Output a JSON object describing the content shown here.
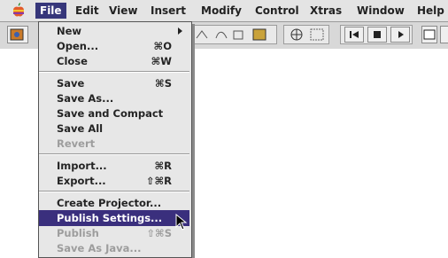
{
  "menubar": {
    "items": [
      "File",
      "Edit",
      "View",
      "Insert",
      "Modify",
      "Control",
      "Xtras",
      "Window",
      "Help"
    ],
    "active": "File"
  },
  "file_menu": {
    "items": [
      {
        "label": "New",
        "shortcut": "",
        "submenu": true,
        "enabled": true,
        "highlighted": false
      },
      {
        "label": "Open...",
        "shortcut": "⌘O",
        "enabled": true,
        "highlighted": false
      },
      {
        "label": "Close",
        "shortcut": "⌘W",
        "enabled": true,
        "highlighted": false
      },
      {
        "label": "Save",
        "shortcut": "⌘S",
        "enabled": true,
        "highlighted": false
      },
      {
        "label": "Save As...",
        "shortcut": "",
        "enabled": true,
        "highlighted": false
      },
      {
        "label": "Save and Compact",
        "shortcut": "",
        "enabled": true,
        "highlighted": false
      },
      {
        "label": "Save All",
        "shortcut": "",
        "enabled": true,
        "highlighted": false
      },
      {
        "label": "Revert",
        "shortcut": "",
        "enabled": false,
        "highlighted": false
      },
      {
        "label": "Import...",
        "shortcut": "⌘R",
        "enabled": true,
        "highlighted": false
      },
      {
        "label": "Export...",
        "shortcut": "⇧⌘R",
        "enabled": true,
        "highlighted": false
      },
      {
        "label": "Create Projector...",
        "shortcut": "",
        "enabled": true,
        "highlighted": false
      },
      {
        "label": "Publish Settings...",
        "shortcut": "",
        "enabled": true,
        "highlighted": true
      },
      {
        "label": "Publish",
        "shortcut": "⇧⌘S",
        "enabled": false,
        "highlighted": false
      },
      {
        "label": "Save As Java...",
        "shortcut": "",
        "enabled": false,
        "highlighted": false
      }
    ]
  },
  "colors": {
    "menubar_bg": "#e4e4e4",
    "highlight": "#3a2f7d",
    "disabled_text": "#9d9d9d"
  },
  "icons": [
    "apple-icon",
    "stop-icon",
    "play-icon",
    "rewind-icon"
  ]
}
